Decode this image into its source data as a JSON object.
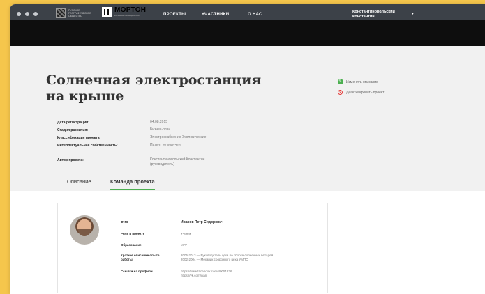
{
  "nav": {
    "logo1_text": "РУССКОЕ ГЕОГРАФИЧЕСКОЕ ОБЩЕСТВО",
    "logo2_title": "МОРТОН",
    "logo2_sub": "ИНЖЕНЕРНЫЕ ЦЕНТРЫ",
    "links": [
      "ПРОЕКТЫ",
      "УЧАСТНИКИ",
      "О НАС"
    ],
    "user_line1": "Константиновольский",
    "user_line2": "Константин",
    "chevron_icon": "chevron-down-icon"
  },
  "project": {
    "title": "Солнечная электростанция на крыше",
    "actions": {
      "edit_label": "Изменить описание",
      "edit_icon": "edit-icon",
      "delete_label": "Деактивировать проект",
      "delete_icon": "delete-icon"
    },
    "info": [
      {
        "label": "Дата регистрации:",
        "value": "04.08.2015"
      },
      {
        "label": "Стадия развития:",
        "value": "Бизнес-план"
      },
      {
        "label": "Классификация проекта:",
        "value": "Электроснабжение Экологические"
      },
      {
        "label": "Интеллектуальная собственность:",
        "value": "Патент не получен"
      },
      {
        "label": "Автор проекта:",
        "value": "Константиновольский Константин",
        "value2": "(руководитель)"
      }
    ]
  },
  "tabs": [
    {
      "label": "Описание",
      "active": false
    },
    {
      "label": "Команда проекта",
      "active": true
    }
  ],
  "team": {
    "member": {
      "rows": [
        {
          "label": "ФИО",
          "value": "Иванов Петр Сидорович"
        },
        {
          "label": "Роль в проекте",
          "value": "Ученик"
        },
        {
          "label": "Образование",
          "value": "МГУ"
        },
        {
          "label": "Краткое описание опыта работы",
          "value": "2005-2013 — Руководитель цеха по сборке солнечных батарей",
          "value2": "2002-2004 — Механик сборочного цеха УМПО"
        },
        {
          "label": "Ссылки на профили",
          "value": "https://www.facebook.com/40051226",
          "value2": "https://vk.com/ivan"
        }
      ]
    }
  },
  "colors": {
    "background": "#f5c64c",
    "navbar": "#0e0e0e",
    "accent": "#4caf50",
    "danger": "#e53935"
  }
}
